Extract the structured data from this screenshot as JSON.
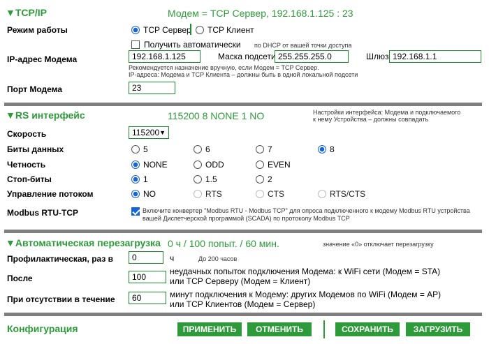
{
  "colors": {
    "accent": "#2e9b3b",
    "radio": "#1565d8",
    "separator": "#7f7f7f"
  },
  "tcpip": {
    "title": "▼TCP/IP",
    "summary": "Модем = TCP Сервер, 192.168.1.125 : 23",
    "mode_label": "Режим работы",
    "mode_options": [
      "TCP Сервер",
      "TCP Клиент"
    ],
    "mode_selected": "TCP Сервер",
    "auto_label": "Получить автоматически",
    "auto_hint": "по DHCP от вашей точки доступа",
    "ip_label": "IP-адрес Модема",
    "ip_value": "192.168.1.125",
    "mask_label": "Маска подсети",
    "mask_value": "255.255.255.0",
    "gw_label": "Шлюз",
    "gw_value": "192.168.1.1",
    "ip_hint1": "Рекомендуется назначение вручную, если Модем = TCP Сервер.",
    "ip_hint2": "IP-адреса: Модема и TCP Клиента – должны быть в одной локальной подсети",
    "port_label": "Порт Модема",
    "port_value": "23"
  },
  "rs": {
    "title": "▼RS интерфейс",
    "summary": "115200 8 NONE 1 NO",
    "hint1": "Настройки интерфейса: Модема и подключаемого",
    "hint2": "к нему Устройства – должны совпадать",
    "speed_label": "Скорость",
    "speed_value": "115200",
    "bits_label": "Биты данных",
    "bits_options": [
      "5",
      "6",
      "7",
      "8"
    ],
    "bits_selected": "8",
    "parity_label": "Четность",
    "parity_options": [
      "NONE",
      "ODD",
      "EVEN"
    ],
    "parity_selected": "NONE",
    "stop_label": "Стоп-биты",
    "stop_options": [
      "1",
      "1.5",
      "2"
    ],
    "stop_selected": "1",
    "flow_label": "Управление потоком",
    "flow_options": [
      "NO",
      "RTS",
      "CTS",
      "RTS/CTS"
    ],
    "flow_selected": "NO",
    "modbus_label": "Modbus RTU-TCP",
    "modbus_hint1": "Включите конвертер \"Modbus RTU - Modbus TCP\" для опроса подключенного к модему Modbus RTU устройства",
    "modbus_hint2": "вашей Диспетчерской программой (SCADA) по протоколу Modbus TCP"
  },
  "reboot": {
    "title": "▼Автоматическая перезагрузка",
    "summary": "0 ч / 100 попыт. / 60 мин.",
    "hint": "значение «0» отключает перезагрузку",
    "prof_label": "Профилактическая, раз в",
    "prof_value": "0",
    "prof_unit": "ч",
    "prof_hint": "До 200 часов",
    "after_label": "После",
    "after_value": "100",
    "after_desc1": "неудачных попыток подключения Модема: к WiFi сети (Модем = STA)",
    "after_desc2": "или TCP Серверу (Модем = Клиент)",
    "absent_label": "При отсутствии в течение",
    "absent_value": "60",
    "absent_desc1": "минут подключения к Модему: других Модемов по WiFi (Модем = AP)",
    "absent_desc2": "или TCP Клиентов (Модем = Сервер)"
  },
  "footer": {
    "title": "Конфигурация",
    "apply": "ПРИМЕНИТЬ",
    "cancel": "ОТМЕНИТЬ",
    "save": "СОХРАНИТЬ",
    "load": "ЗАГРУЗИТЬ"
  }
}
